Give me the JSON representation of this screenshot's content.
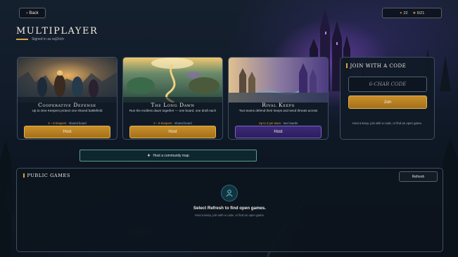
{
  "nav": {
    "back_label": "Back",
    "back_icon": "chevron-left-icon"
  },
  "status": {
    "gems": "22",
    "progress": "5/21",
    "gem_icon": "gem-icon",
    "progress_icon": "crest-icon"
  },
  "header": {
    "title": "Multiplayer",
    "signed_in": "Signed in as ssj2rich"
  },
  "modes": [
    {
      "name": "Cooperative Defense",
      "description": "Up to nine Keepers protect one shared battlefield",
      "players": "2 – 9 Keepers",
      "board": "shared board",
      "button": "Host",
      "button_style": "gold"
    },
    {
      "name": "The Long Dawn",
      "description": "Run the endless dawn together — one board, one draft each",
      "players": "2 – 9 Keepers",
      "board": "shared board",
      "button": "Host",
      "button_style": "gold"
    },
    {
      "name": "Rival Keeps",
      "description": "Two teams defend their keeps and send threats across",
      "players": "Up to 4 per team",
      "board": "two boards",
      "button": "Host",
      "button_style": "purple"
    }
  ],
  "join": {
    "title": "Join with a Code",
    "placeholder": "6-CHAR CODE",
    "button": "Join",
    "hint": "Host a keep, join with a code, or find an open game."
  },
  "community": {
    "label": "Host a community map",
    "icon": "plus-icon"
  },
  "public_games": {
    "title": "Public Games",
    "refresh_label": "Refresh",
    "empty_icon": "user-icon",
    "empty_message": "Select Refresh to find open games.",
    "empty_hint": "Host a keep, join with a code, or find an open game."
  },
  "colors": {
    "accent_gold": "#d9a540",
    "host_gold": "#c98f2a",
    "host_purple": "#3d2a78",
    "community_border": "#5aa08a",
    "panel_bg": "#101a26"
  }
}
